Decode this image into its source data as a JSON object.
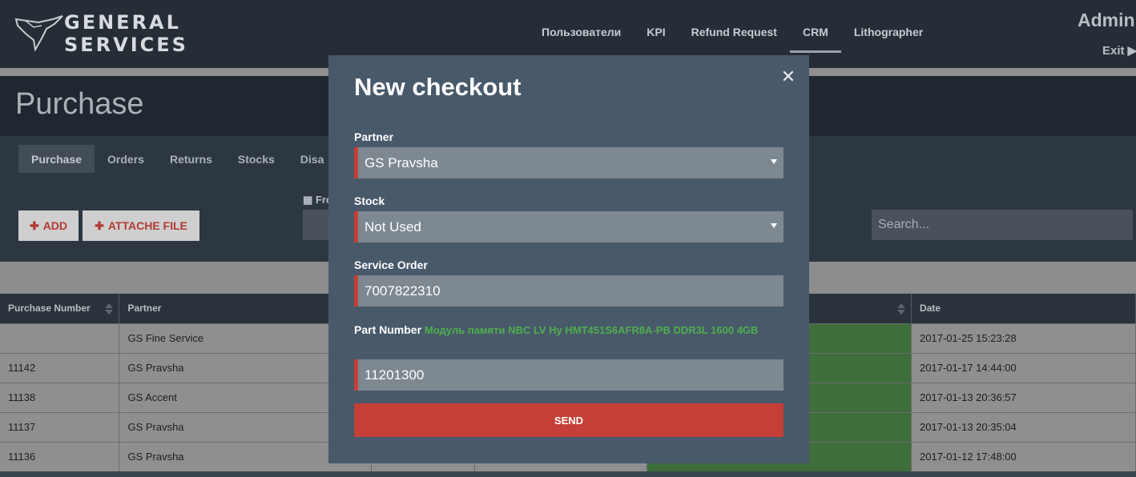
{
  "brand": {
    "line1": "GENERAL",
    "line2": "SERVICES"
  },
  "nav": {
    "items": [
      "Пользователи",
      "KPI",
      "Refund Request",
      "CRM",
      "Lithographer"
    ],
    "active": "CRM"
  },
  "user": {
    "name": "Admin",
    "exit": "Exit ▶"
  },
  "page": {
    "title": "Purchase"
  },
  "tabs": [
    "Purchase",
    "Orders",
    "Returns",
    "Stocks",
    "Disa"
  ],
  "toolbar": {
    "add_label": "ADD",
    "attach_label": "ATTACHE FILE",
    "from_label": "Fro",
    "search_placeholder": "Search..."
  },
  "table": {
    "headers": [
      "Purchase Number",
      "Partner",
      "",
      "",
      "",
      "Date"
    ],
    "rows": [
      {
        "number": "",
        "partner": "GS Fine Service",
        "date": "2017-01-25 15:23:28"
      },
      {
        "number": "11142",
        "partner": "GS Pravsha",
        "date": "2017-01-17 14:44:00"
      },
      {
        "number": "11138",
        "partner": "GS Accent",
        "date": "2017-01-13 20:36:57"
      },
      {
        "number": "11137",
        "partner": "GS Pravsha",
        "date": "2017-01-13 20:35:04"
      },
      {
        "number": "11136",
        "partner": "GS Pravsha",
        "date": "2017-01-12 17:48:00"
      }
    ]
  },
  "modal": {
    "title": "New checkout",
    "partner_label": "Partner",
    "partner_value": "GS Pravsha",
    "stock_label": "Stock",
    "stock_value": "Not Used",
    "service_order_label": "Service Order",
    "service_order_value": "7007822310",
    "part_number_label": "Part Number",
    "part_number_desc": "Модуль памяти NBC LV Hy HMT451S6AFR8A-PB DDR3L 1600 4GB",
    "part_number_value": "11201300",
    "send_label": "SEND"
  },
  "colors": {
    "accent": "#c53f38",
    "green": "#4faf4d",
    "modal_bg": "#48596a"
  }
}
